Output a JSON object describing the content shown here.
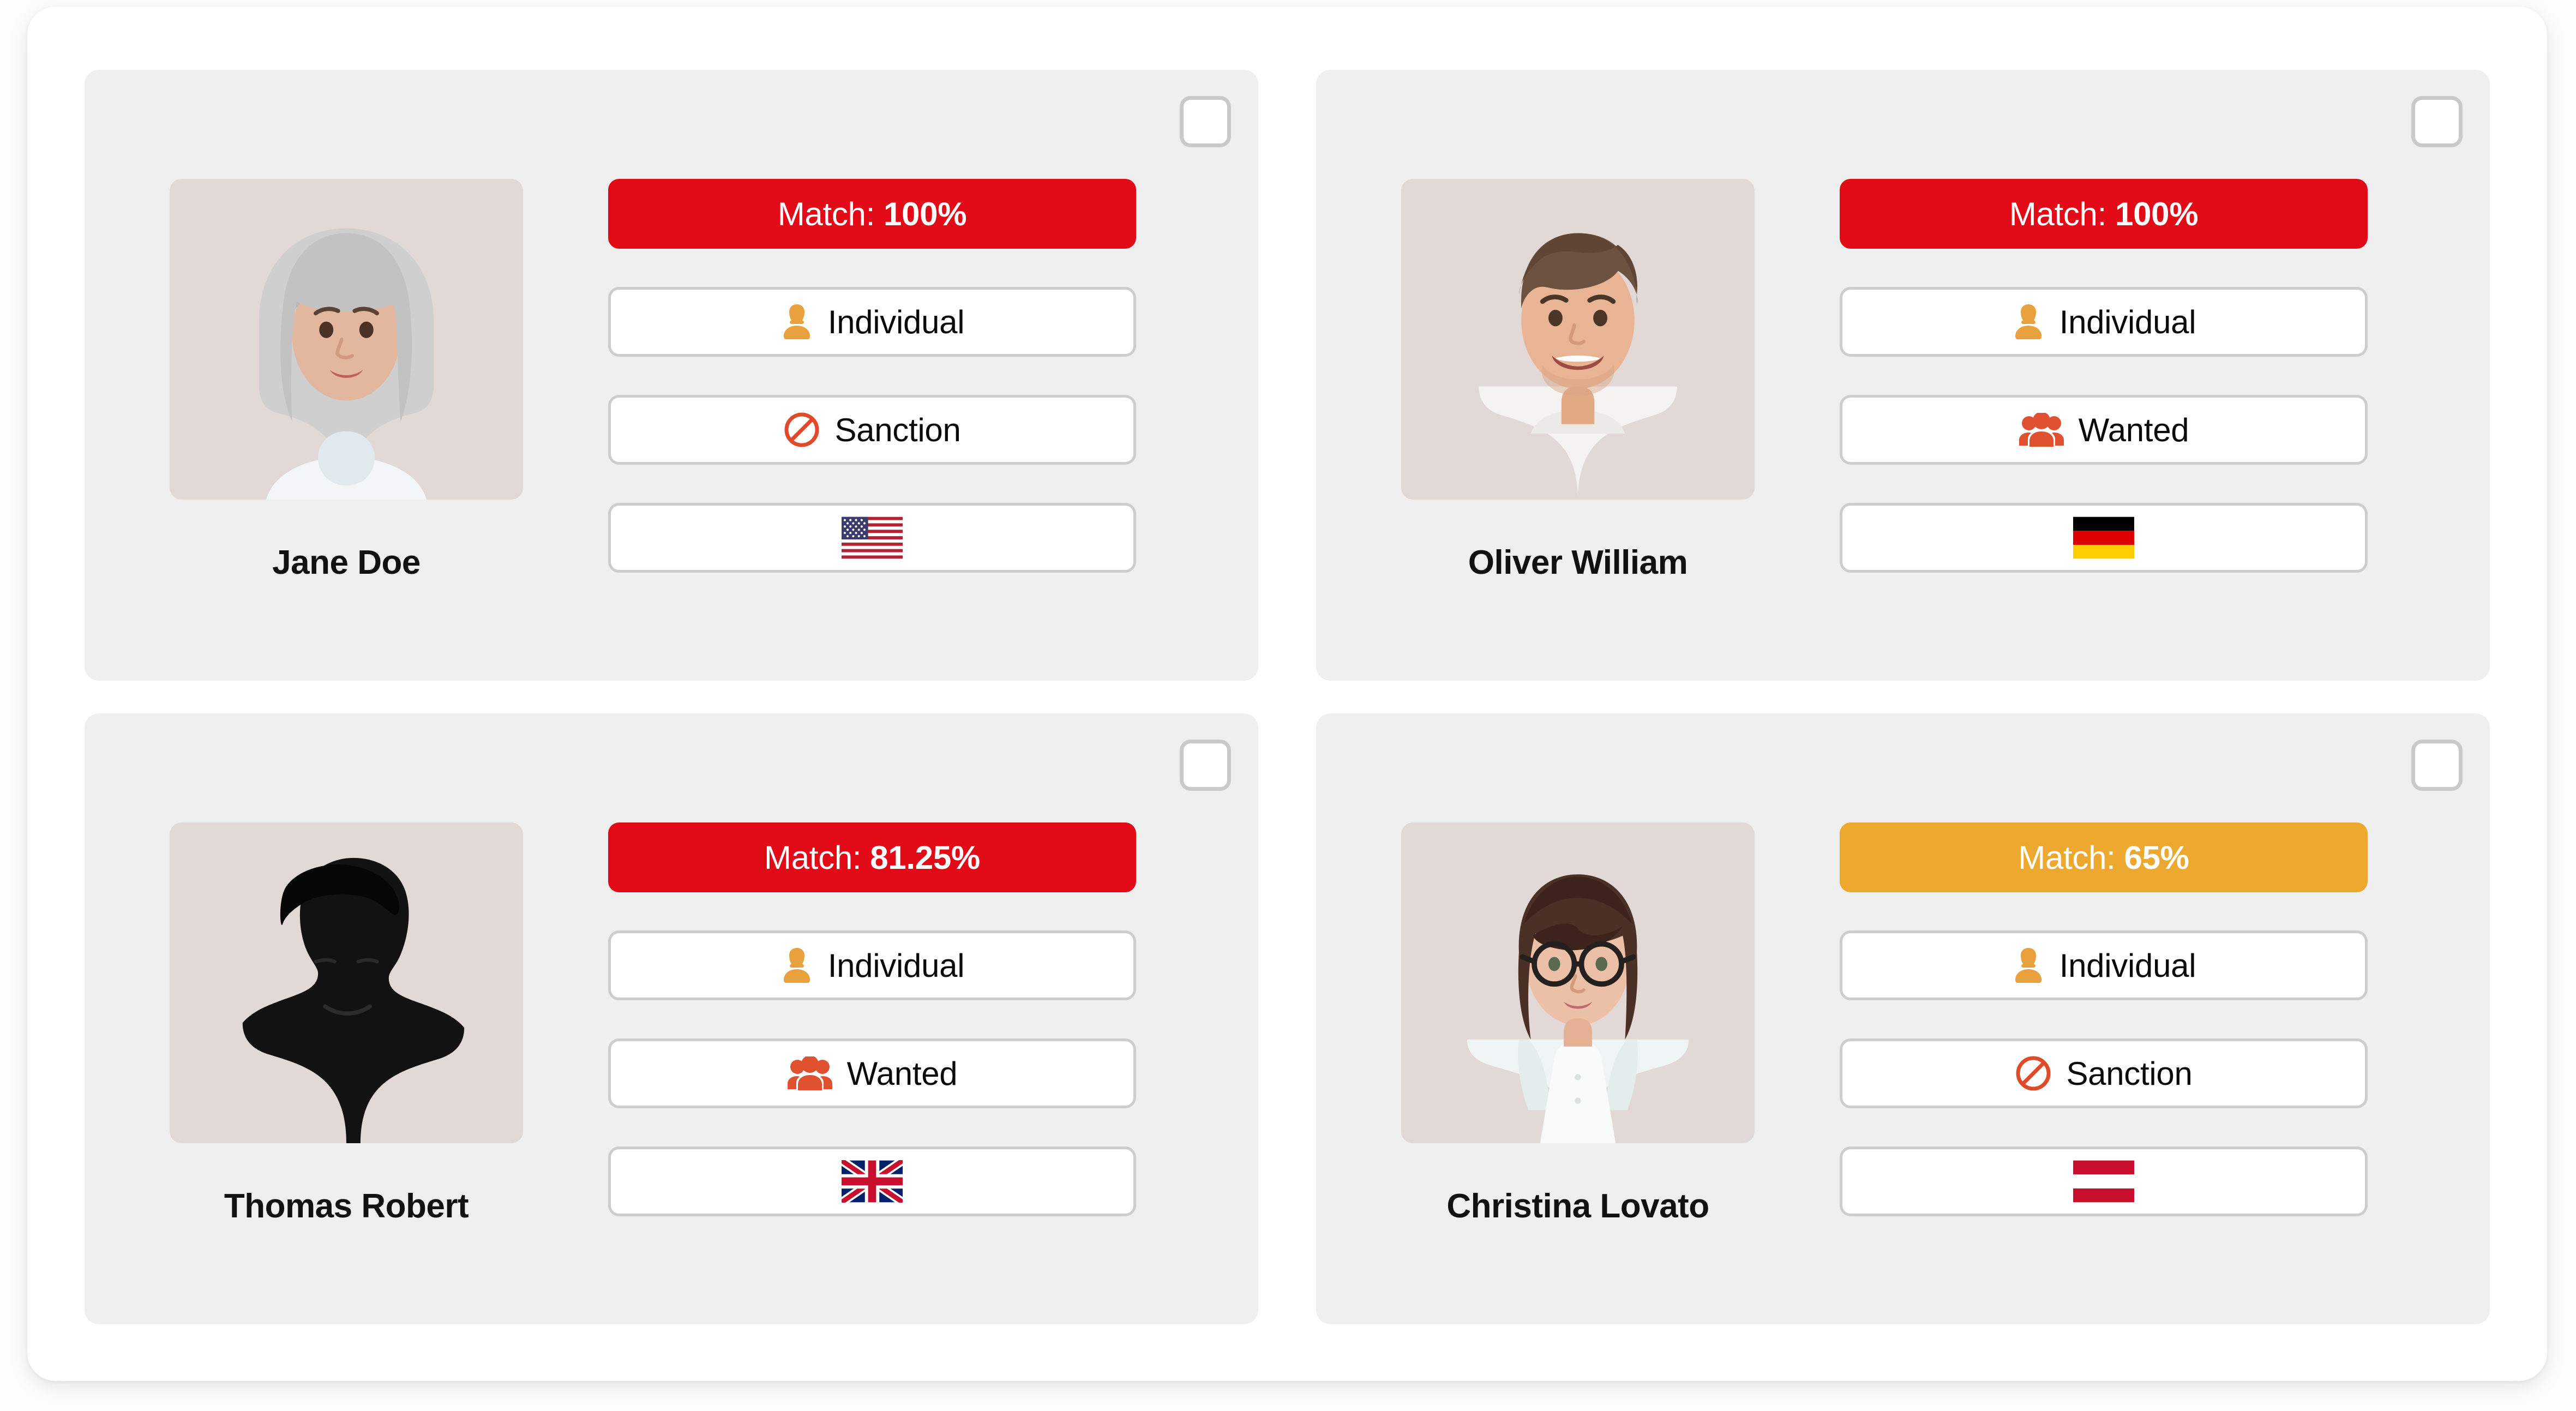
{
  "theme": {
    "page_background": "#fdfdfd",
    "panel_background": "#ffffff",
    "card_background": "#efefef",
    "match_high_color": "#e30a17",
    "match_medium_color": "#eda92f",
    "individual_icon_color": "#e8a13c",
    "wanted_icon_color": "#e0512f",
    "sanction_icon_color": "#df4b2a",
    "pill_border_color": "#cdcdcd",
    "photo_background": "#e2d8d6",
    "name_text_color": "#111111"
  },
  "results": [
    {
      "name": "Jane Doe",
      "photo": "woman-grey-hair-white-shirt",
      "checkbox_checked": false,
      "match": {
        "label": "Match:",
        "value": "100%",
        "level": "high"
      },
      "type": {
        "label": "Individual",
        "icon": "person-icon"
      },
      "list": {
        "label": "Sanction",
        "icon": "prohibited-icon"
      },
      "country": {
        "code": "US",
        "name": "United States",
        "icon": "flag-us-icon"
      }
    },
    {
      "name": "Oliver William",
      "photo": "man-brown-hair-white-sweater",
      "checkbox_checked": false,
      "match": {
        "label": "Match:",
        "value": "100%",
        "level": "high"
      },
      "type": {
        "label": "Individual",
        "icon": "person-icon"
      },
      "list": {
        "label": "Wanted",
        "icon": "people-group-icon"
      },
      "country": {
        "code": "DE",
        "name": "Germany",
        "icon": "flag-de-icon"
      }
    },
    {
      "name": "Thomas Robert",
      "photo": "silhouette-man-placeholder",
      "checkbox_checked": false,
      "match": {
        "label": "Match:",
        "value": "81.25%",
        "level": "high"
      },
      "type": {
        "label": "Individual",
        "icon": "person-icon"
      },
      "list": {
        "label": "Wanted",
        "icon": "people-group-icon"
      },
      "country": {
        "code": "GB",
        "name": "United Kingdom",
        "icon": "flag-gb-icon"
      }
    },
    {
      "name": "Christina Lovato",
      "photo": "woman-glasses-bob-haircut",
      "checkbox_checked": false,
      "match": {
        "label": "Match:",
        "value": "65%",
        "level": "medium"
      },
      "type": {
        "label": "Individual",
        "icon": "person-icon"
      },
      "list": {
        "label": "Sanction",
        "icon": "prohibited-icon"
      },
      "country": {
        "code": "AT",
        "name": "Austria",
        "icon": "flag-at-icon"
      }
    }
  ]
}
